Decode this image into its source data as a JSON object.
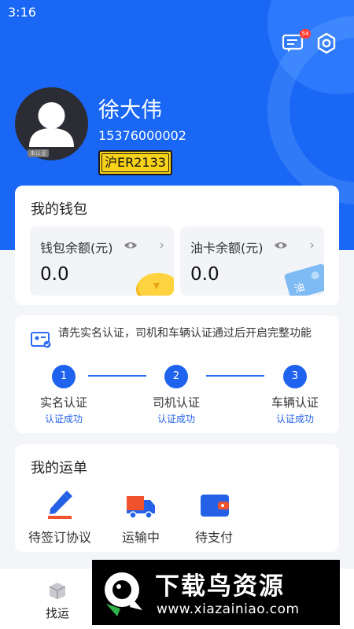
{
  "status_bar": {
    "time": "3:16"
  },
  "header": {
    "message_badge_count": "54",
    "icons": [
      "message-icon",
      "settings-icon"
    ]
  },
  "profile": {
    "name": "徐大伟",
    "phone": "15376000002",
    "plate": "沪ER2133",
    "avatar_tag": "未认证"
  },
  "wallet": {
    "title": "我的钱包",
    "balance_label": "钱包余额(元)",
    "balance_value": "0.0",
    "fuel_label": "油卡余额(元)",
    "fuel_value": "0.0",
    "fuel_card_text": "油"
  },
  "auth": {
    "notice": "请先实名认证，司机和车辆认证通过后开启完整功能",
    "steps": [
      {
        "num": "1",
        "label": "实名认证",
        "status": "认证成功"
      },
      {
        "num": "2",
        "label": "司机认证",
        "status": "认证成功"
      },
      {
        "num": "3",
        "label": "车辆认证",
        "status": "认证成功"
      }
    ]
  },
  "orders": {
    "title": "我的运单",
    "items": [
      {
        "label": "待签订协议",
        "icon": "pen-icon"
      },
      {
        "label": "运输中",
        "icon": "truck-icon"
      },
      {
        "label": "待支付",
        "icon": "wallet-icon"
      }
    ]
  },
  "bottom_nav": {
    "items": [
      {
        "label": "找运",
        "icon": "box-icon"
      }
    ]
  },
  "watermark": {
    "title": "下载鸟资源",
    "url": "www.xiazainiao.com"
  },
  "colors": {
    "primary": "#1a67f5",
    "accent_orange": "#f0522d",
    "plate_yellow": "#f7d21a"
  }
}
